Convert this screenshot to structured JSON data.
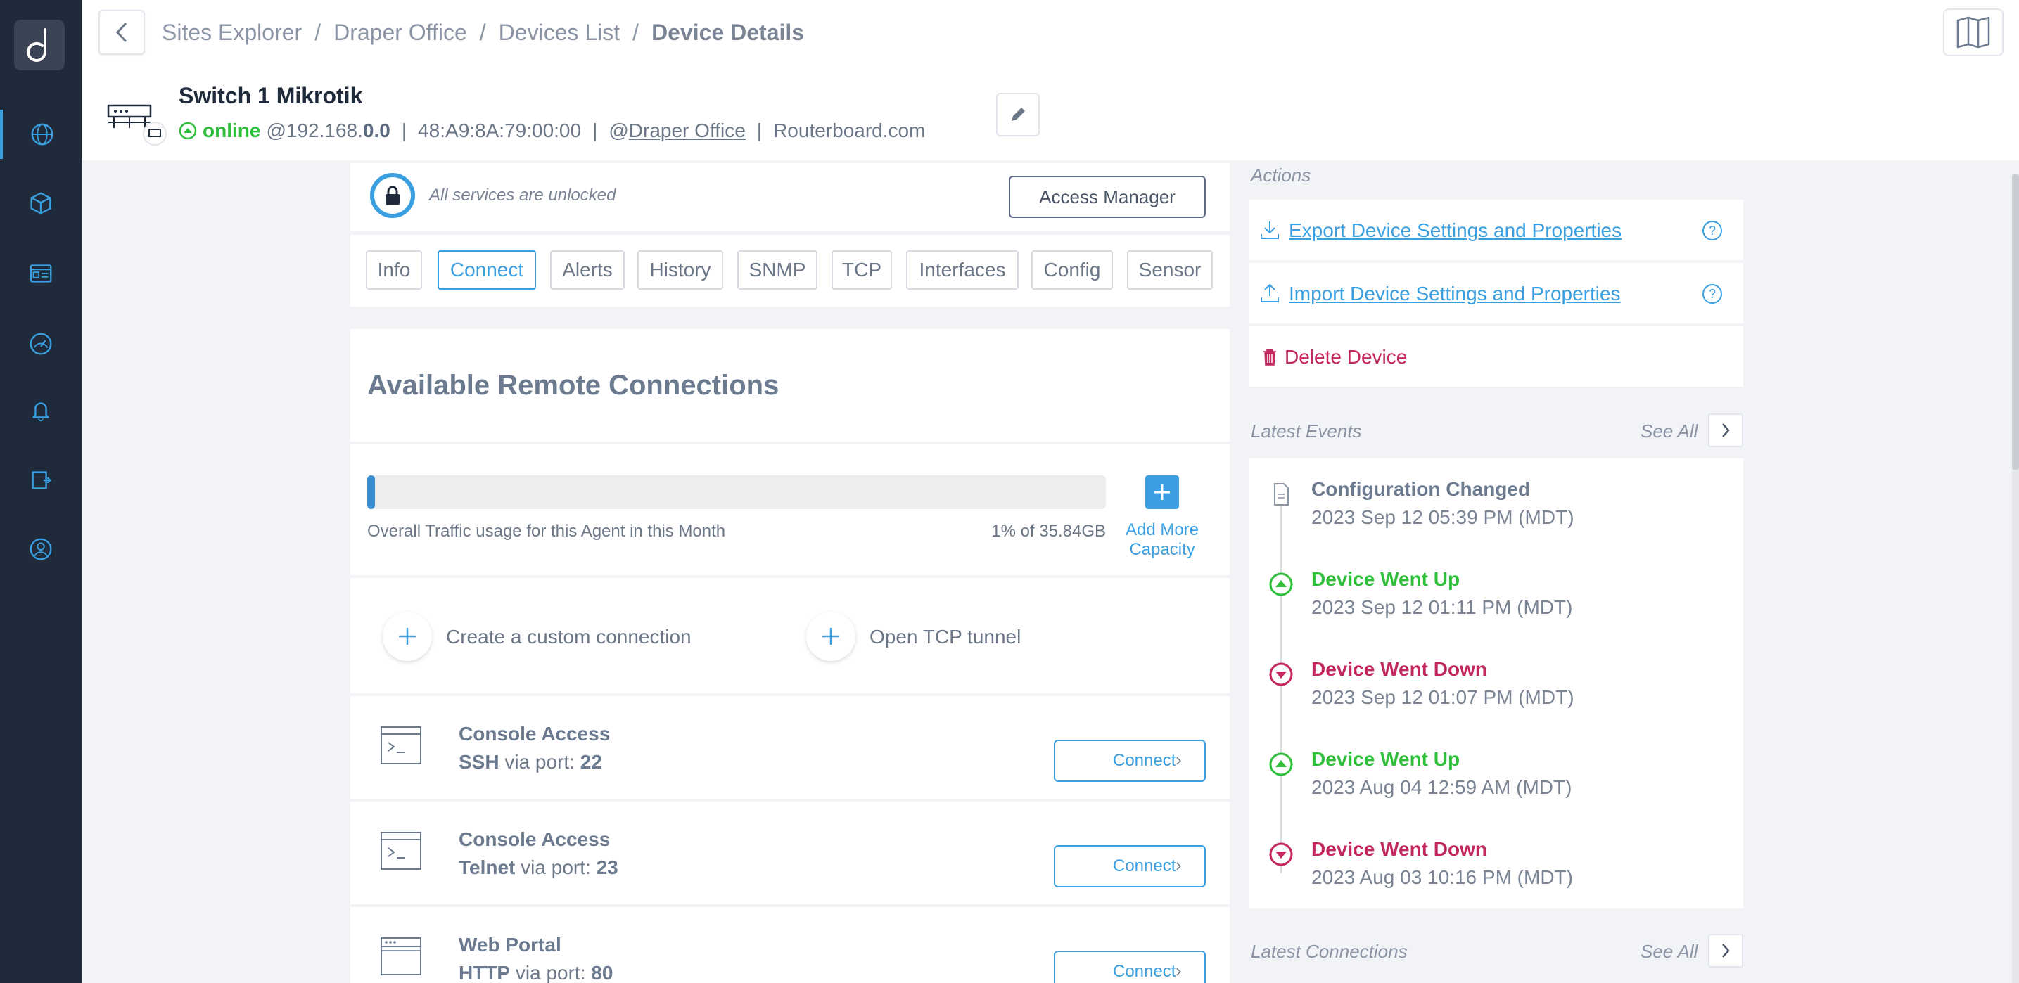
{
  "breadcrumb": {
    "items": [
      "Sites Explorer",
      "Draper Office",
      "Devices List"
    ],
    "current": "Device Details",
    "separator": "/"
  },
  "device": {
    "name": "Switch 1 Mikrotik",
    "status": "online",
    "ip_prefix": "@192.168.",
    "ip_suffix": "0.0",
    "mac": "48:A9:8A:79:00:00",
    "site_prefix": "@",
    "site": "Draper Office",
    "vendor": "Routerboard.com"
  },
  "lock": {
    "text": "All services are unlocked",
    "button": "Access Manager"
  },
  "tabs": [
    {
      "label": "Info",
      "active": false
    },
    {
      "label": "Connect",
      "active": true
    },
    {
      "label": "Alerts",
      "active": false
    },
    {
      "label": "History",
      "active": false
    },
    {
      "label": "SNMP",
      "active": false
    },
    {
      "label": "TCP",
      "active": false
    },
    {
      "label": "Interfaces",
      "active": false
    },
    {
      "label": "Config",
      "active": false
    },
    {
      "label": "Sensor",
      "active": false
    }
  ],
  "remote": {
    "title": "Available Remote Connections",
    "traffic_label": "Overall Traffic usage for this Agent in this Month",
    "traffic_value": "1% of 35.84GB",
    "traffic_percent": 1,
    "add_more": "Add More Capacity",
    "create_custom": "Create a custom connection",
    "open_tcp": "Open TCP tunnel"
  },
  "connections": [
    {
      "title": "Console Access",
      "protocol": "SSH",
      "via": "via port:",
      "port": "22",
      "button": "Connect",
      "icon": "terminal-icon"
    },
    {
      "title": "Console Access",
      "protocol": "Telnet",
      "via": "via port:",
      "port": "23",
      "button": "Connect",
      "icon": "terminal-icon"
    },
    {
      "title": "Web Portal",
      "protocol": "HTTP",
      "via": "via port:",
      "port": "80",
      "button": "Connect",
      "icon": "browser-icon"
    }
  ],
  "actions": {
    "label": "Actions",
    "export": "Export Device Settings and Properties",
    "import": "Import Device Settings and Properties",
    "delete": "Delete Device",
    "help": "?"
  },
  "events": {
    "label": "Latest Events",
    "see_all": "See All",
    "items": [
      {
        "type": "info",
        "title": "Configuration Changed",
        "time": "2023 Sep 12 05:39 PM (MDT)"
      },
      {
        "type": "up",
        "title": "Device Went Up",
        "time": "2023 Sep 12 01:11 PM (MDT)"
      },
      {
        "type": "down",
        "title": "Device Went Down",
        "time": "2023 Sep 12 01:07 PM (MDT)"
      },
      {
        "type": "up",
        "title": "Device Went Up",
        "time": "2023 Aug 04 12:59 AM (MDT)"
      },
      {
        "type": "down",
        "title": "Device Went Down",
        "time": "2023 Aug 03 10:16 PM (MDT)"
      }
    ]
  },
  "latest_connections": {
    "label": "Latest Connections",
    "see_all": "See All"
  },
  "colors": {
    "sidebar": "#1f2a3a",
    "accent": "#3a9fe0",
    "online": "#2fbf3a",
    "danger": "#c2275f"
  }
}
